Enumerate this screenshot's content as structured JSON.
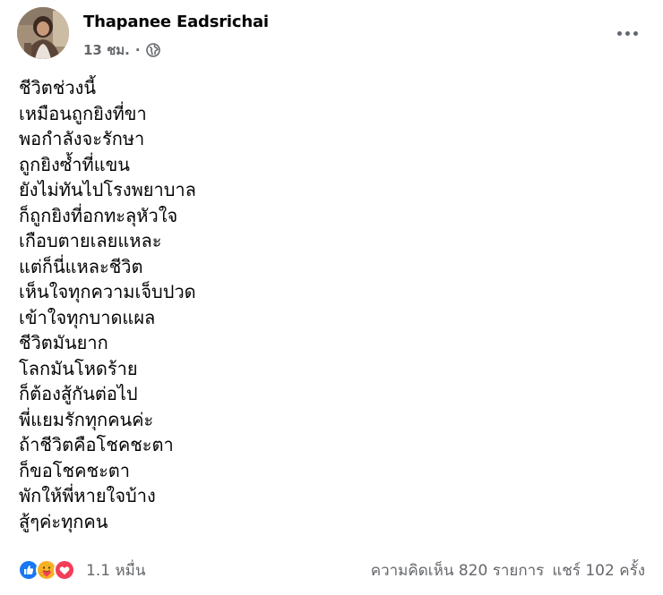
{
  "author": {
    "name": "Thapanee Eadsrichai",
    "time": "13 ชม.",
    "separator": "·",
    "privacy_icon": "globe-icon"
  },
  "post": {
    "lines": [
      "ชีวิตช่วงนี้",
      "เหมือนถูกยิงที่ขา",
      "พอกำลังจะรักษา",
      "ถูกยิงซ้ำที่แขน",
      "ยังไม่ทันไปโรงพยาบาล",
      "ก็ถูกยิงที่อกทะลุหัวใจ",
      "เกือบตายเลยแหละ",
      "แต่ก็นี่แหละชีวิต",
      "เห็นใจทุกความเจ็บปวด",
      "เข้าใจทุกบาดแผล",
      "ชีวิตมันยาก",
      "โลกมันโหดร้าย",
      "ก็ต้องสู้กันต่อไป",
      "พี่แยมรักทุกคนค่ะ",
      "ถ้าชีวิตคือโชคชะตา",
      "ก็ขอโชคชะตา",
      "พักให้พี่หายใจบ้าง",
      "สู้ๆค่ะทุกคน"
    ]
  },
  "footer": {
    "reactions": [
      "like-icon",
      "care-icon",
      "love-icon"
    ],
    "reaction_count": "1.1 หมื่น",
    "comments": "ความคิดเห็น 820 รายการ",
    "shares": "แชร์ 102 ครั้ง"
  },
  "colors": {
    "text": "#050505",
    "secondary": "#65676b",
    "like_blue": "#1877f2",
    "love_red": "#f33e58",
    "care_yellow": "#f7b125"
  }
}
